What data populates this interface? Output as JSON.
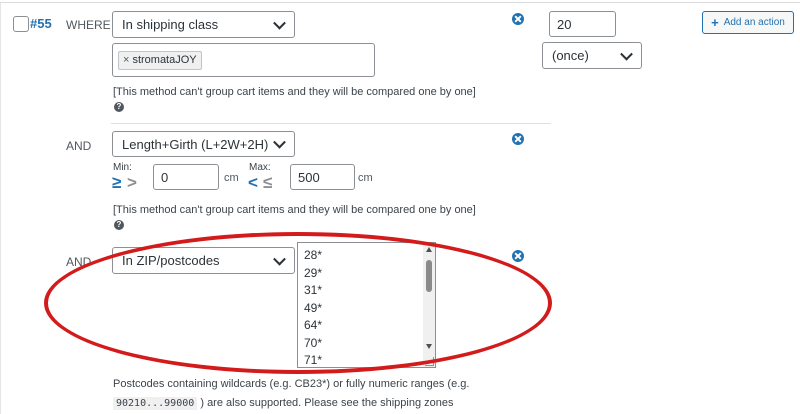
{
  "rule": {
    "id": "#55",
    "where_label": "WHERE",
    "cond1": {
      "select": "In shipping class",
      "tag": "stromataJOY",
      "tag_remove": "×",
      "note": "[This method can't group cart items and they will be compared one by one]",
      "help": "?"
    },
    "quantity": "20",
    "frequency": "(once)",
    "add_action": "Add an action",
    "cond2": {
      "and_label": "AND",
      "select": "Length+Girth (L+2W+2H)",
      "min_label": "Min:",
      "max_label": "Max:",
      "min_icon": "≥",
      "max_icon": "≤",
      "min_value": "0",
      "max_value": "500",
      "min_unit": "cm",
      "max_unit": "cm",
      "note": "[This method can't group cart items and they will be compared one by one]",
      "help": "?"
    },
    "cond3": {
      "and_label": "AND",
      "select": "In ZIP/postcodes",
      "postcodes": [
        "28*",
        "29*",
        "31*",
        "49*",
        "64*",
        "70*",
        "71*"
      ],
      "help_line1": "Postcodes containing wildcards (e.g. CB23*) or fully numeric ranges (e.g.",
      "help_code": "90210...99000",
      "help_line2": ") are also supported. Please see the shipping zones"
    }
  },
  "colors": {
    "accent": "#2271b1",
    "highlight_ellipse": "#d31b1b",
    "min_icon": "#2271b1",
    "max_icon": "#2271b1"
  }
}
